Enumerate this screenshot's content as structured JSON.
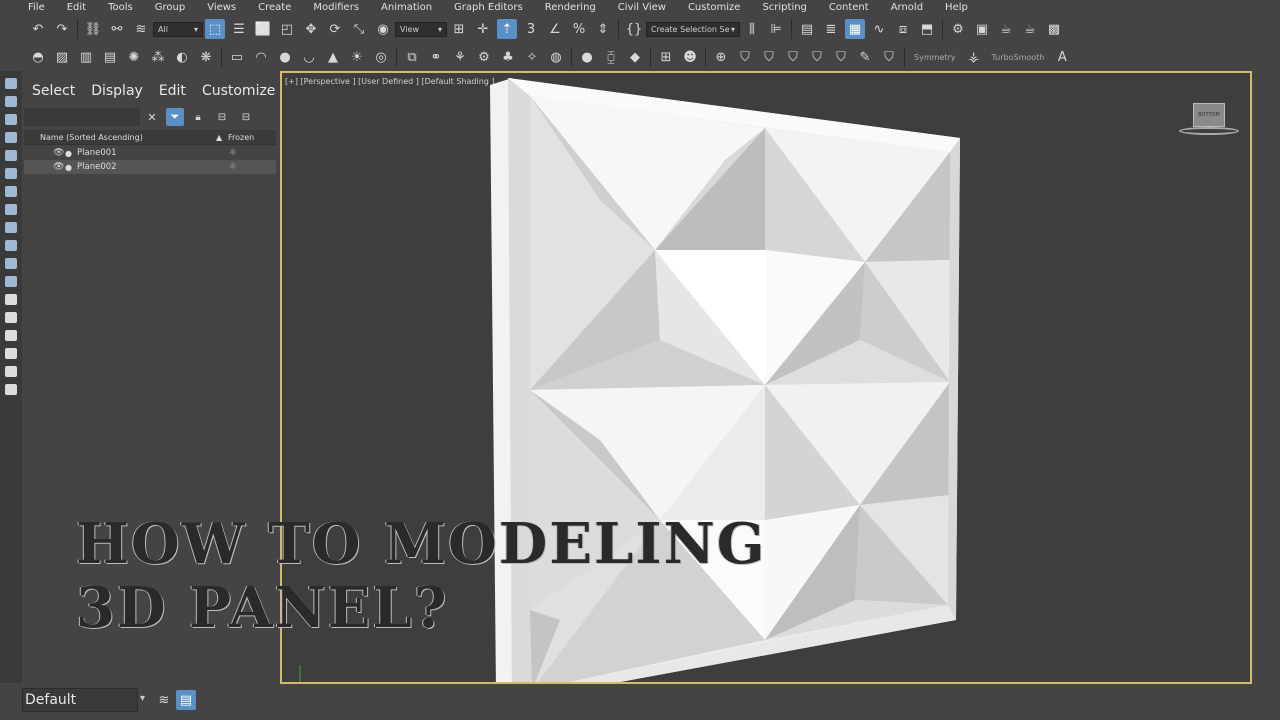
{
  "menu": {
    "items": [
      "File",
      "Edit",
      "Tools",
      "Group",
      "Views",
      "Create",
      "Modifiers",
      "Animation",
      "Graph Editors",
      "Rendering",
      "Civil View",
      "Customize",
      "Scripting",
      "Content",
      "Arnold",
      "Help"
    ]
  },
  "toolbar": {
    "selection_filter": "All",
    "reference_coord": "View",
    "named_selection": "Create Selection Se",
    "symmetry_label": "Symmetry",
    "turbosmooth_label": "TurboSmooth"
  },
  "scene_explorer": {
    "menu": [
      "Select",
      "Display",
      "Edit",
      "Customize"
    ],
    "column_name": "Name (Sorted Ascending)",
    "column_frozen": "Frozen",
    "objects": [
      {
        "name": "Plane001",
        "selected": false
      },
      {
        "name": "Plane002",
        "selected": true
      }
    ]
  },
  "viewport": {
    "label": "[+] [Perspective ] [User Defined ] [Default Shading ]",
    "viewcube_label": "BOTTOM"
  },
  "layer": {
    "current": "Default"
  },
  "overlay_text": {
    "line1": "HOW TO MODELING",
    "line2": "3D PANEL?"
  },
  "colors": {
    "ui_background": "#444444",
    "viewport_border": "#d6b96a",
    "active_button": "#5a8fc7"
  }
}
